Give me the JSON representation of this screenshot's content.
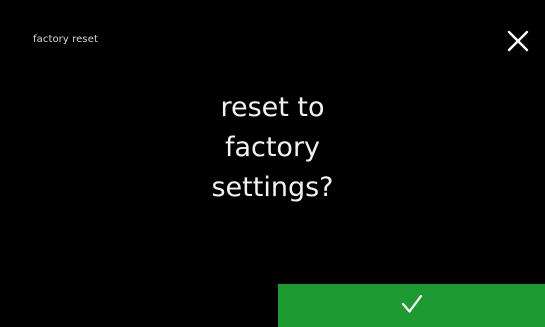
{
  "header": {
    "title": "factory reset",
    "close_icon": "close-icon"
  },
  "dialog": {
    "prompt_lines": [
      "reset to",
      "factory",
      "settings?"
    ]
  },
  "actions": {
    "confirm_icon": "checkmark-icon"
  },
  "colors": {
    "background": "#000000",
    "text": "#f2f2f2",
    "title_text": "#d8d8d8",
    "confirm_background": "#1e9a33",
    "icon": "#ffffff"
  }
}
